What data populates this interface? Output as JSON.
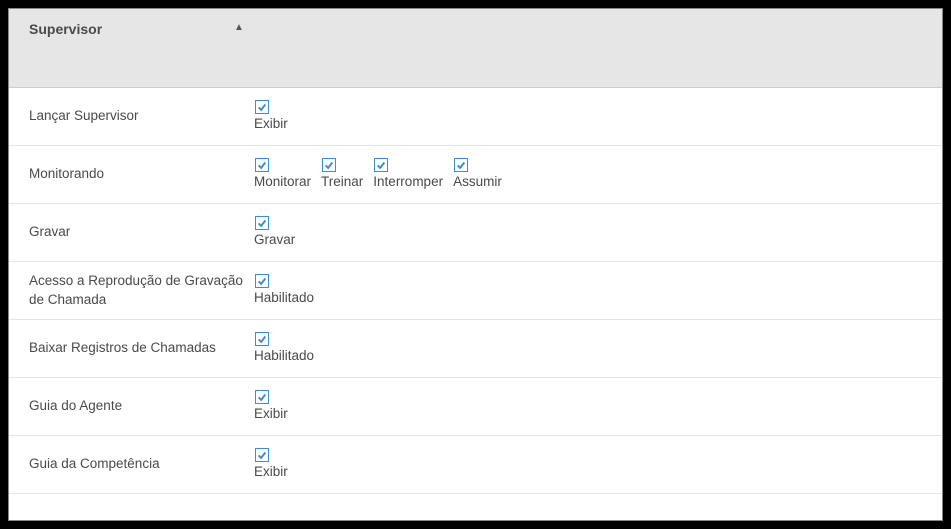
{
  "header": {
    "title": "Supervisor"
  },
  "rows": [
    {
      "label": "Lançar Supervisor",
      "options": [
        {
          "label": "Exibir",
          "checked": true
        }
      ]
    },
    {
      "label": "Monitorando",
      "options": [
        {
          "label": "Monitorar",
          "checked": true
        },
        {
          "label": "Treinar",
          "checked": true
        },
        {
          "label": "Interromper",
          "checked": true
        },
        {
          "label": "Assumir",
          "checked": true
        }
      ]
    },
    {
      "label": "Gravar",
      "options": [
        {
          "label": "Gravar",
          "checked": true
        }
      ]
    },
    {
      "label": "Acesso a Reprodução de Gravação de Chamada",
      "options": [
        {
          "label": "Habilitado",
          "checked": true
        }
      ]
    },
    {
      "label": "Baixar Registros de Chamadas",
      "options": [
        {
          "label": "Habilitado",
          "checked": true
        }
      ]
    },
    {
      "label": "Guia do Agente",
      "options": [
        {
          "label": "Exibir",
          "checked": true
        }
      ]
    },
    {
      "label": "Guia da Competência",
      "options": [
        {
          "label": "Exibir",
          "checked": true
        }
      ]
    }
  ]
}
